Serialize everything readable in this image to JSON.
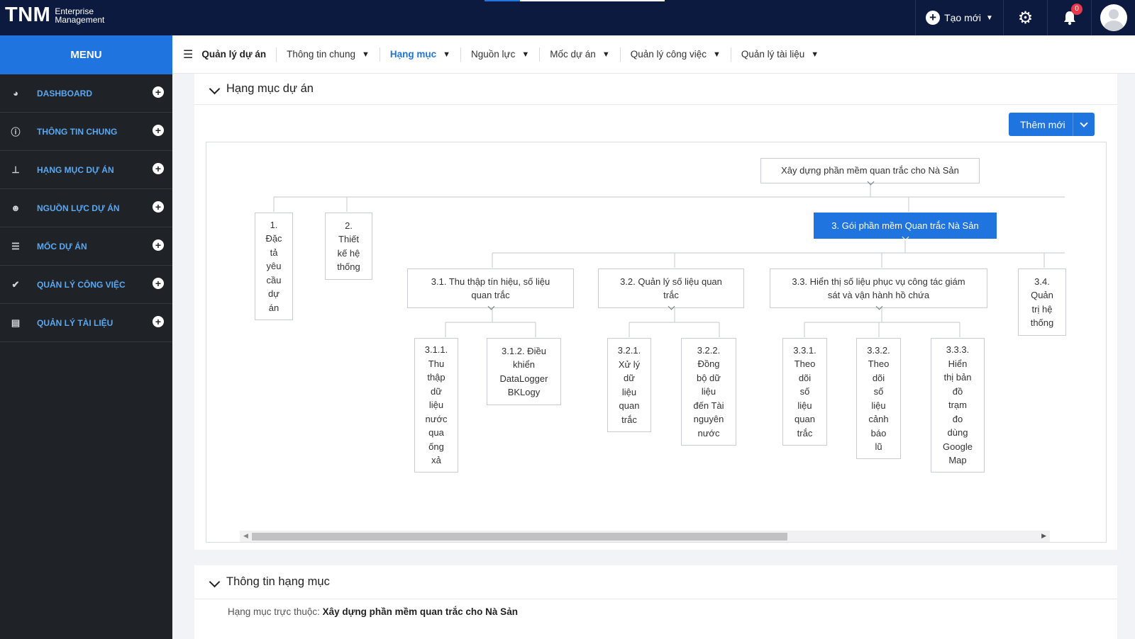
{
  "header": {
    "logo_main": "TNM",
    "logo_sub1": "Enterprise",
    "logo_sub2": "Management",
    "create_label": "Tạo mới",
    "notif_count": "0"
  },
  "sidebar": {
    "title": "MENU",
    "items": [
      {
        "label": "DASHBOARD",
        "icon": "pie-chart-icon"
      },
      {
        "label": "THÔNG TIN CHUNG",
        "icon": "info-icon"
      },
      {
        "label": "HẠNG MỤC DỰ ÁN",
        "icon": "sitemap-icon"
      },
      {
        "label": "NGUỒN LỰC DỰ ÁN",
        "icon": "users-icon"
      },
      {
        "label": "MỐC DỰ ÁN",
        "icon": "sliders-icon"
      },
      {
        "label": "QUẢN LÝ CÔNG VIỆC",
        "icon": "clipboard-check-icon"
      },
      {
        "label": "QUẢN LÝ TÀI LIỆU",
        "icon": "document-icon"
      }
    ]
  },
  "nav": {
    "items": [
      {
        "label": "Quản lý dự án"
      },
      {
        "label": "Thông tin chung"
      },
      {
        "label": "Hạng mục"
      },
      {
        "label": "Nguồn lực"
      },
      {
        "label": "Mốc dự án"
      },
      {
        "label": "Quản lý công việc"
      },
      {
        "label": "Quản lý tài liệu"
      }
    ]
  },
  "section1": {
    "title": "Hạng mục dự án",
    "add_button": "Thêm mới"
  },
  "tree": {
    "root": "Xây dựng phần mềm quan trắc cho Nà Sản",
    "n1": "1.<br>Đặc<br>tả<br>yêu<br>cầu<br>dự<br>án",
    "n2": "2.<br>Thiết<br>kế hệ<br>thống",
    "n3": "3. Gói phần mềm Quan trắc Nà Sản",
    "n31": "3.1. Thu thập tín hiệu, số liệu<br>quan trắc",
    "n32": "3.2. Quản lý số liệu quan<br>trắc",
    "n33": "3.3. Hiển thị số liệu phục vụ công tác giám<br>sát và vận hành hồ chứa",
    "n34": "3.4.<br>Quản<br>trị hệ<br>thống",
    "n311": "3.1.1.<br>Thu<br>thập<br>dữ<br>liệu<br>nước<br>qua<br>ống<br>xả",
    "n312": "3.1.2. Điều<br>khiển<br>DataLogger<br>BKLogy",
    "n321": "3.2.1.<br>Xử lý<br>dữ<br>liệu<br>quan<br>trắc",
    "n322": "3.2.2.<br>Đồng<br>bộ dữ<br>liệu<br>đến Tài<br>nguyên<br>nước",
    "n331": "3.3.1.<br>Theo<br>dõi<br>số<br>liệu<br>quan<br>trắc",
    "n332": "3.3.2.<br>Theo<br>dõi<br>số<br>liệu<br>cảnh<br>báo<br>lũ",
    "n333": "3.3.3.<br>Hiển<br>thị bản<br>đồ<br>trạm<br>đo<br>dùng<br>Google<br>Map"
  },
  "section2": {
    "title": "Thông tin hạng mục",
    "parent_label": "Hạng mục trực thuộc:",
    "parent_value": "Xây dựng phần mềm quan trắc cho Nà Sản"
  },
  "colors": {
    "topbar": "#0d1a3f",
    "accent": "#1f74e0",
    "sidebar": "#1f2226",
    "sidebar_text": "#5aa8f2"
  }
}
